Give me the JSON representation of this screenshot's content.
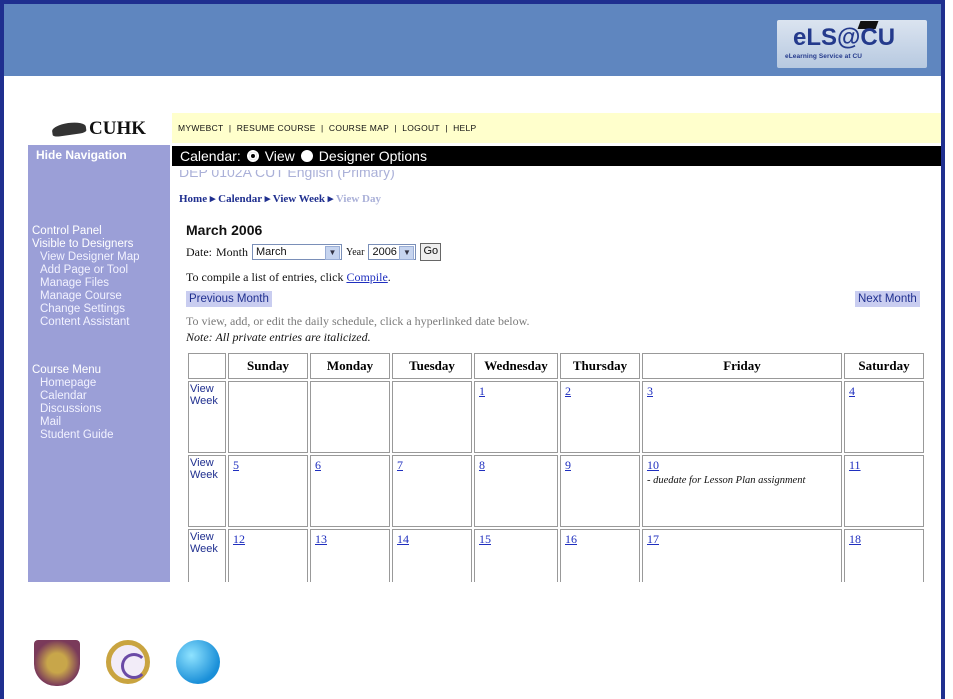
{
  "brand": {
    "logo": "eLS@CU",
    "subtitle": "eLearning Service at CU"
  },
  "institution": {
    "name": "CUHK"
  },
  "sidebar": {
    "hide_nav": "Hide Navigation",
    "control_panel": "Control Panel",
    "visible_to_designers": "Visible to Designers",
    "designer_items": [
      "View Designer Map",
      "Add Page or Tool",
      "Manage Files",
      "Manage Course",
      "Change Settings",
      "Content Assistant"
    ],
    "course_menu": "Course Menu",
    "course_items": [
      "Homepage",
      "Calendar",
      "Discussions",
      "Mail",
      "Student Guide"
    ]
  },
  "topnav": {
    "items": [
      "MYWEBCT",
      "RESUME COURSE",
      "COURSE MAP",
      "LOGOUT",
      "HELP"
    ],
    "separator": "|"
  },
  "calbar": {
    "label": "Calendar:",
    "view": "View",
    "designer": "Designer Options",
    "selected": "View"
  },
  "course_title_cut": "DEP 0102A CUT English (Primary)",
  "breadcrumb": {
    "home": "Home",
    "calendar": "Calendar",
    "week": "View Week",
    "day": "View Day"
  },
  "month_title": "March 2006",
  "date_select": {
    "date_label": "Date:",
    "month_label": "Month",
    "month_value": "March",
    "year_label": "Year",
    "year_value": "2006",
    "go": "Go"
  },
  "compile": {
    "text": "To compile a list of entries, click ",
    "link": "Compile",
    "end": "."
  },
  "prev_month": "Previous Month",
  "next_month": "Next Month",
  "hint": "To view, add, or edit the daily schedule, click a hyperlinked date below.",
  "note": "Note: All private entries are italicized.",
  "calendar": {
    "days": [
      "Sunday",
      "Monday",
      "Tuesday",
      "Wednesday",
      "Thursday",
      "Friday",
      "Saturday"
    ],
    "view_week": "View Week",
    "weeks": [
      [
        "",
        "",
        "",
        "1",
        "2",
        "3",
        "4"
      ],
      [
        "5",
        "6",
        "7",
        "8",
        "9",
        "10",
        "11"
      ],
      [
        "12",
        "13",
        "14",
        "15",
        "16",
        "17",
        "18"
      ]
    ],
    "event_10": "- duedate for Lesson Plan assignment"
  }
}
